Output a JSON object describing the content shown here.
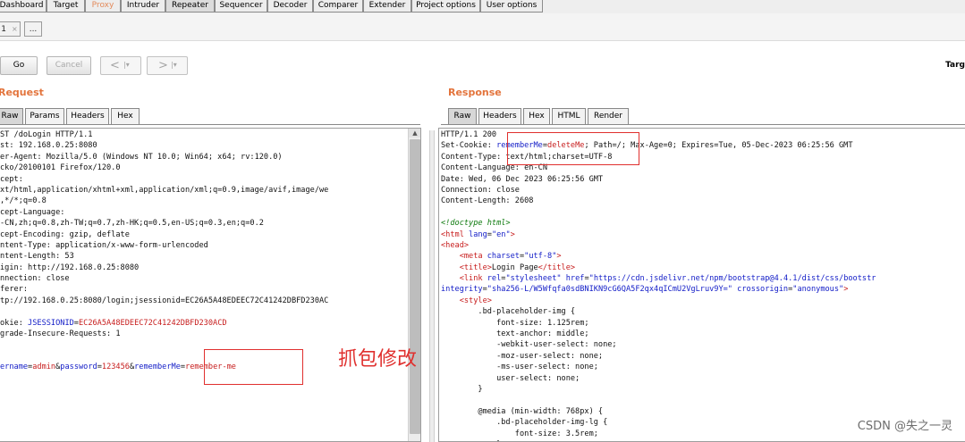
{
  "main_tabs": [
    "Dashboard",
    "Target",
    "Proxy",
    "Intruder",
    "Repeater",
    "Sequencer",
    "Decoder",
    "Comparer",
    "Extender",
    "Project options",
    "User options"
  ],
  "sub_tabs": {
    "first": "1",
    "close": "×",
    "more": "..."
  },
  "toolbar": {
    "go": "Go",
    "cancel": "Cancel",
    "back_arrow": "<",
    "fwd_arrow": ">",
    "dropdown": "|▾",
    "target_label": "Targ"
  },
  "request": {
    "title": "Request",
    "tabs": [
      "Raw",
      "Params",
      "Headers",
      "Hex"
    ],
    "lines": [
      [
        {
          "t": "ST /doLogin HTTP/1.1"
        }
      ],
      [
        {
          "t": "st: 192.168.0.25:8080"
        }
      ],
      [
        {
          "t": "er-Agent: Mozilla/5.0 (Windows NT 10.0; Win64; x64; rv:120.0)"
        }
      ],
      [
        {
          "t": "cko/20100101 Firefox/120.0"
        }
      ],
      [
        {
          "t": "cept:"
        }
      ],
      [
        {
          "t": "xt/html,application/xhtml+xml,application/xml;q=0.9,image/avif,image/we"
        }
      ],
      [
        {
          "t": ",*/*;q=0.8"
        }
      ],
      [
        {
          "t": "cept-Language:"
        }
      ],
      [
        {
          "t": "-CN,zh;q=0.8,zh-TW;q=0.7,zh-HK;q=0.5,en-US;q=0.3,en;q=0.2"
        }
      ],
      [
        {
          "t": "cept-Encoding: gzip, deflate"
        }
      ],
      [
        {
          "t": "ntent-Type: application/x-www-form-urlencoded"
        }
      ],
      [
        {
          "t": "ntent-Length: 53"
        }
      ],
      [
        {
          "t": "igin: http://192.168.0.25:8080"
        }
      ],
      [
        {
          "t": "nnection: close"
        }
      ],
      [
        {
          "t": "ferer:"
        }
      ],
      [
        {
          "t": "tp://192.168.0.25:8080/login;jsessionid=EC26A5A48EDEEC72C41242DBFD230AC"
        }
      ],
      [
        {
          "t": ""
        }
      ],
      [
        {
          "t": "okie: "
        },
        {
          "t": "JSESSIONID",
          "c": "k"
        },
        {
          "t": "="
        },
        {
          "t": "EC26A5A48EDEEC72C41242DBFD230ACD",
          "c": "r"
        }
      ],
      [
        {
          "t": "grade-Insecure-Requests: 1"
        }
      ],
      [
        {
          "t": ""
        }
      ],
      [
        {
          "t": ""
        }
      ],
      [
        {
          "t": "ername",
          "c": "k"
        },
        {
          "t": "="
        },
        {
          "t": "admin",
          "c": "r"
        },
        {
          "t": "&"
        },
        {
          "t": "password",
          "c": "k"
        },
        {
          "t": "="
        },
        {
          "t": "123456",
          "c": "r"
        },
        {
          "t": "&"
        },
        {
          "t": "rememberMe",
          "c": "k"
        },
        {
          "t": "="
        },
        {
          "t": "remember-me",
          "c": "r"
        }
      ]
    ]
  },
  "response": {
    "title": "Response",
    "tabs": [
      "Raw",
      "Headers",
      "Hex",
      "HTML",
      "Render"
    ],
    "lines": [
      [
        {
          "t": "HTTP/1.1 200"
        }
      ],
      [
        {
          "t": "Set-Cookie: "
        },
        {
          "t": "rememberMe",
          "c": "k"
        },
        {
          "t": "="
        },
        {
          "t": "deleteMe",
          "c": "r"
        },
        {
          "t": "; Path=/; Max-Age=0; Expires=Tue, 05-Dec-2023 06:25:56 GMT"
        }
      ],
      [
        {
          "t": "Content-Type: text/html;charset=UTF-8"
        }
      ],
      [
        {
          "t": "Content-Language: en-CN"
        }
      ],
      [
        {
          "t": "Date: Wed, 06 Dec 2023 06:25:56 GMT"
        }
      ],
      [
        {
          "t": "Connection: close"
        }
      ],
      [
        {
          "t": "Content-Length: 2608"
        }
      ],
      [
        {
          "t": ""
        }
      ],
      [
        {
          "t": "<!doctype html>",
          "c": "g"
        }
      ],
      [
        {
          "t": "<html ",
          "c": "r"
        },
        {
          "t": "lang",
          "c": "k"
        },
        {
          "t": "="
        },
        {
          "t": "\"en\"",
          "c": "k"
        },
        {
          "t": ">",
          "c": "r"
        }
      ],
      [
        {
          "t": "<head>",
          "c": "r"
        }
      ],
      [
        {
          "t": "    "
        },
        {
          "t": "<meta ",
          "c": "r"
        },
        {
          "t": "charset",
          "c": "k"
        },
        {
          "t": "="
        },
        {
          "t": "\"utf-8\"",
          "c": "k"
        },
        {
          "t": ">",
          "c": "r"
        }
      ],
      [
        {
          "t": "    "
        },
        {
          "t": "<title>",
          "c": "r"
        },
        {
          "t": "Login Page"
        },
        {
          "t": "</title>",
          "c": "r"
        }
      ],
      [
        {
          "t": "    "
        },
        {
          "t": "<link ",
          "c": "r"
        },
        {
          "t": "rel",
          "c": "k"
        },
        {
          "t": "="
        },
        {
          "t": "\"stylesheet\"",
          "c": "k"
        },
        {
          "t": " "
        },
        {
          "t": "href",
          "c": "k"
        },
        {
          "t": "="
        },
        {
          "t": "\"https://cdn.jsdelivr.net/npm/bootstrap@4.4.1/dist/css/bootstr",
          "c": "k"
        }
      ],
      [
        {
          "t": "integrity",
          "c": "k"
        },
        {
          "t": "="
        },
        {
          "t": "\"sha256-L/W5Wfqfa0sdBNIKN9cG6QA5F2qx4qICmU2VgLruv9Y=\"",
          "c": "k"
        },
        {
          "t": " "
        },
        {
          "t": "crossorigin",
          "c": "k"
        },
        {
          "t": "="
        },
        {
          "t": "\"anonymous\"",
          "c": "k"
        },
        {
          "t": ">",
          "c": "r"
        }
      ],
      [
        {
          "t": "    "
        },
        {
          "t": "<style>",
          "c": "r"
        }
      ],
      [
        {
          "t": "        .bd-placeholder-img {"
        }
      ],
      [
        {
          "t": "            font-size: 1.125rem;"
        }
      ],
      [
        {
          "t": "            text-anchor: middle;"
        }
      ],
      [
        {
          "t": "            -webkit-user-select: none;"
        }
      ],
      [
        {
          "t": "            -moz-user-select: none;"
        }
      ],
      [
        {
          "t": "            -ms-user-select: none;"
        }
      ],
      [
        {
          "t": "            user-select: none;"
        }
      ],
      [
        {
          "t": "        }"
        }
      ],
      [
        {
          "t": ""
        }
      ],
      [
        {
          "t": "        @media (min-width: 768px) {"
        }
      ],
      [
        {
          "t": "            .bd-placeholder-img-lg {"
        }
      ],
      [
        {
          "t": "                font-size: 3.5rem;"
        }
      ],
      [
        {
          "t": "            }"
        }
      ]
    ]
  },
  "annotation": "抓包修改",
  "watermark": "CSDN @失之一灵",
  "colors": {
    "accent": "#e3743c",
    "keyword": "#1620c8",
    "value": "#c71d1d",
    "highlight": "#e0302e"
  }
}
